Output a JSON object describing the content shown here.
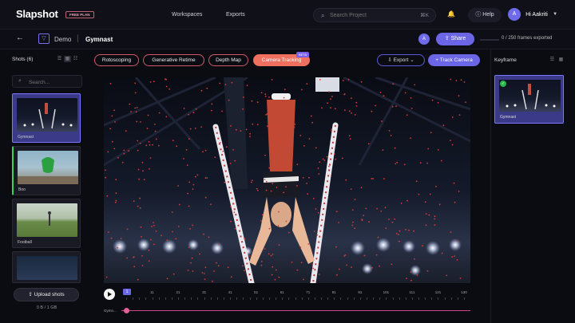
{
  "app": {
    "logo": "Slapshot",
    "plan_badge": "FREE PLAN"
  },
  "nav": {
    "workspaces": "Workspaces",
    "exports": "Exports"
  },
  "search": {
    "icon": "search-icon",
    "placeholder": "Search Project",
    "shortcut": "⌘K"
  },
  "header": {
    "help": "Help",
    "user_initial": "A",
    "user_greeting": "Hi Aakriti"
  },
  "project": {
    "name": "Demo",
    "shot_title": "Gymnast",
    "collaborator_initial": "A",
    "share_label": "Share",
    "frames_exported": "0 / 250 frames exported",
    "export_progress": 0
  },
  "shots": {
    "title": "Shots (6)",
    "search_placeholder": "Search...",
    "items": [
      {
        "label": "Gymnast",
        "active": true
      },
      {
        "label": "Boo",
        "active": false
      },
      {
        "label": "Football",
        "active": false
      },
      {
        "label": "",
        "active": false
      }
    ],
    "upload_label": "Upload shots",
    "storage": "0 B / 1 GB"
  },
  "modes": {
    "items": [
      "Rotoscoping",
      "Generative Retime",
      "Depth Map",
      "Camera Tracking"
    ],
    "active": "Camera Tracking",
    "beta_label": "BETA"
  },
  "toolbar": {
    "export_label": "Export",
    "track_camera_label": "+ Track Camera"
  },
  "timeline": {
    "current_frame": "1",
    "ticks": [
      "1",
      "11",
      "21",
      "31",
      "41",
      "51",
      "61",
      "71",
      "81",
      "91",
      "101",
      "111",
      "121",
      "130"
    ],
    "track_label": "Gymn..."
  },
  "keyframe": {
    "title": "Keyframe",
    "card_label": "Gymnast"
  },
  "colors": {
    "accent": "#6b66e6",
    "mode_active": "#f07060",
    "mode_border": "#d05868",
    "track_line": "#d04888"
  }
}
